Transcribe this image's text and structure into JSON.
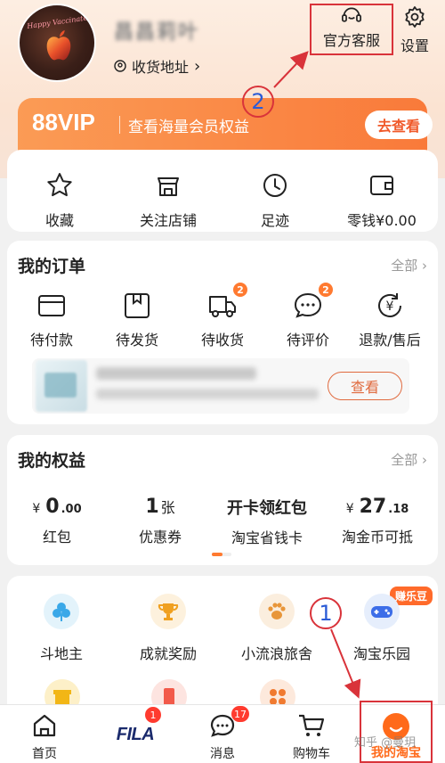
{
  "header": {
    "avatar_signature": "Happy Vaccinated",
    "username": "昌昌莉叶",
    "address_label": "收货地址",
    "address_chevron": "›",
    "customer_service_label": "官方客服",
    "settings_label": "设置"
  },
  "vip": {
    "logo": "88VIP",
    "text": "查看海量会员权益",
    "button": "去查看"
  },
  "quick_items": [
    {
      "label": "收藏",
      "icon": "star-icon"
    },
    {
      "label": "关注店铺",
      "icon": "store-icon"
    },
    {
      "label": "足迹",
      "icon": "clock-icon"
    },
    {
      "label": "零钱¥0.00",
      "icon": "wallet-icon"
    }
  ],
  "orders": {
    "title": "我的订单",
    "more": "全部 ›",
    "items": [
      {
        "label": "待付款",
        "icon": "card-icon",
        "badge": ""
      },
      {
        "label": "待发货",
        "icon": "package-icon",
        "badge": ""
      },
      {
        "label": "待收货",
        "icon": "truck-icon",
        "badge": "2"
      },
      {
        "label": "待评价",
        "icon": "comment-icon",
        "badge": "2"
      },
      {
        "label": "退款/售后",
        "icon": "refund-icon",
        "badge": ""
      }
    ],
    "shipping_view_button": "查看"
  },
  "rights": {
    "title": "我的权益",
    "more": "全部 ›",
    "items": [
      {
        "currency": "¥",
        "value": "0",
        "decimal": ".00",
        "unit": "",
        "label": "红包"
      },
      {
        "currency": "",
        "value": "1",
        "decimal": "",
        "unit": "张",
        "label": "优惠券"
      },
      {
        "currency": "",
        "value": "开卡领红包",
        "decimal": "",
        "unit": "",
        "label": "淘宝省钱卡"
      },
      {
        "currency": "¥",
        "value": "27",
        "decimal": ".18",
        "unit": "",
        "label": "淘金币可抵"
      }
    ]
  },
  "games": {
    "earn_badge": "赚乐豆",
    "items": [
      {
        "label": "斗地主",
        "icon": "clover-icon",
        "color": "#e3f3fb"
      },
      {
        "label": "成就奖励",
        "icon": "trophy-icon",
        "color": "#fdf1dd"
      },
      {
        "label": "小流浪旅舍",
        "icon": "paw-icon",
        "color": "#fbeede"
      },
      {
        "label": "淘宝乐园",
        "icon": "gamepad-icon",
        "color": "#e6eefc"
      }
    ]
  },
  "annotations": {
    "marker_1": "1",
    "marker_2": "2"
  },
  "tabbar": {
    "items": [
      {
        "label": "首页",
        "icon": "home-icon"
      },
      {
        "label": "消息",
        "icon": "chat-icon",
        "badge": "17"
      },
      {
        "label": "购物车",
        "icon": "cart-icon"
      }
    ],
    "fila_logo": "FILA",
    "fila_badge": "1",
    "my_taobao": "我的淘宝"
  },
  "watermark": "知乎 @曼玥",
  "colors": {
    "accent": "#ff6a1a",
    "badge": "#ff7a30",
    "annotation": "#d9333a",
    "marker_text": "#2a5bd6"
  }
}
